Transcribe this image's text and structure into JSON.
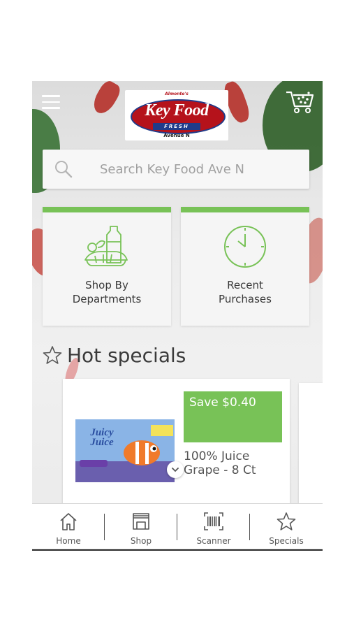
{
  "header": {
    "logo": {
      "top_text": "Almonte's",
      "main_text": "Key Food",
      "fresh_text": "FRESH",
      "location": "Avenue N"
    }
  },
  "search": {
    "placeholder": "Search Key Food Ave N"
  },
  "tiles": [
    {
      "label_line1": "Shop By",
      "label_line2": "Departments",
      "icon": "groceries-icon"
    },
    {
      "label_line1": "Recent",
      "label_line2": "Purchases",
      "icon": "clock-icon"
    }
  ],
  "hot_specials": {
    "title": "Hot specials",
    "products": [
      {
        "save_label": "Save $0.40",
        "name_line1": "100% Juice",
        "name_line2": "Grape - 8 Ct",
        "brand_line1": "Juicy",
        "brand_line2": "Juice"
      }
    ]
  },
  "bottom_nav": [
    {
      "label": "Home",
      "icon": "home-icon"
    },
    {
      "label": "Shop",
      "icon": "shop-icon"
    },
    {
      "label": "Scanner",
      "icon": "barcode-icon"
    },
    {
      "label": "Specials",
      "icon": "star-icon"
    }
  ],
  "colors": {
    "accent_green": "#78c257",
    "logo_red": "#b5121b",
    "logo_blue": "#1f3b8a"
  }
}
